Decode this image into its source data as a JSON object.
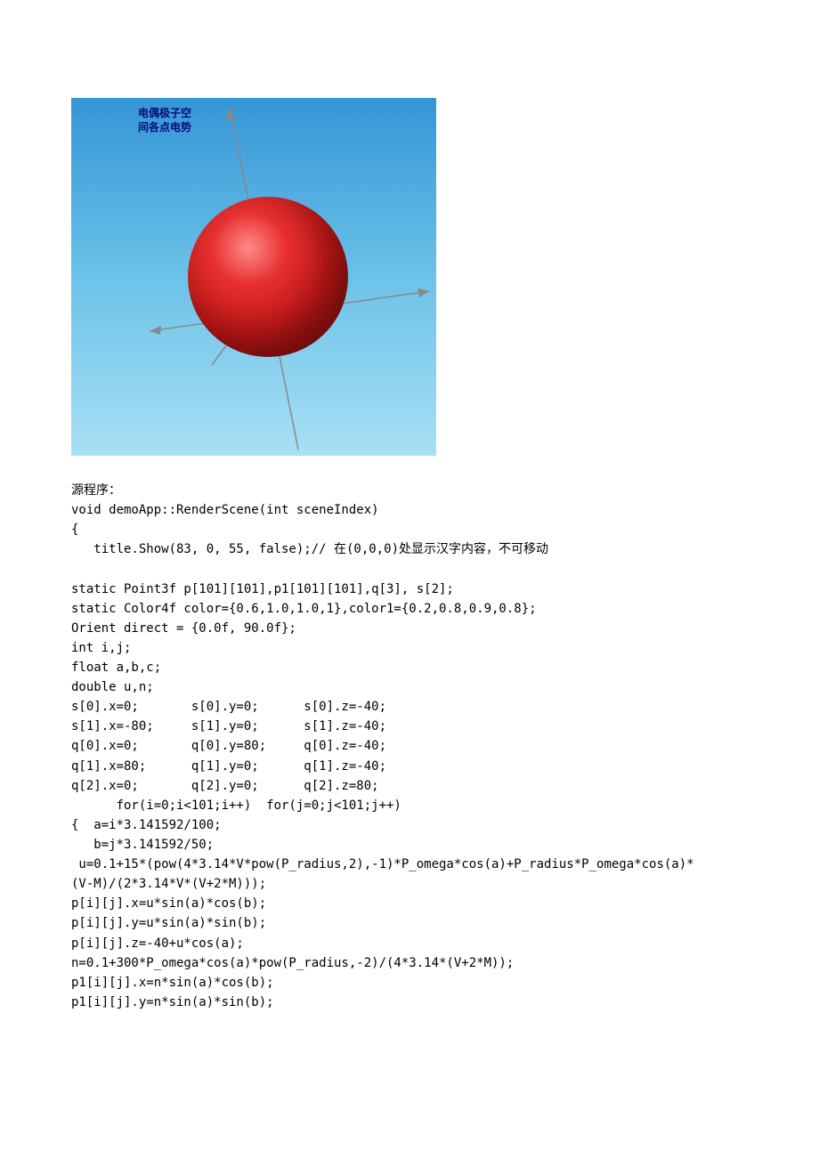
{
  "figure": {
    "title_line1": "电偶极子空",
    "title_line2": "间各点电势"
  },
  "section_label": "源程序：",
  "code": "void demoApp::RenderScene(int sceneIndex)\n{\n   title.Show(83, 0, 55, false);// 在(0,0,0)处显示汉字内容，不可移动\n\nstatic Point3f p[101][101],p1[101][101],q[3], s[2];\nstatic Color4f color={0.6,1.0,1.0,1},color1={0.2,0.8,0.9,0.8};\nOrient direct = {0.0f, 90.0f};\nint i,j;\nfloat a,b,c;\ndouble u,n;\ns[0].x=0;       s[0].y=0;      s[0].z=-40;\ns[1].x=-80;     s[1].y=0;      s[1].z=-40;\nq[0].x=0;       q[0].y=80;     q[0].z=-40;\nq[1].x=80;      q[1].y=0;      q[1].z=-40;\nq[2].x=0;       q[2].y=0;      q[2].z=80;\n      for(i=0;i<101;i++)  for(j=0;j<101;j++)\n{  a=i*3.141592/100;\n   b=j*3.141592/50;\n u=0.1+15*(pow(4*3.14*V*pow(P_radius,2),-1)*P_omega*cos(a)+P_radius*P_omega*cos(a)*\n(V-M)/(2*3.14*V*(V+2*M)));\np[i][j].x=u*sin(a)*cos(b);\np[i][j].y=u*sin(a)*sin(b);\np[i][j].z=-40+u*cos(a);\nn=0.1+300*P_omega*cos(a)*pow(P_radius,-2)/(4*3.14*(V+2*M));\np1[i][j].x=n*sin(a)*cos(b);\np1[i][j].y=n*sin(a)*sin(b);"
}
